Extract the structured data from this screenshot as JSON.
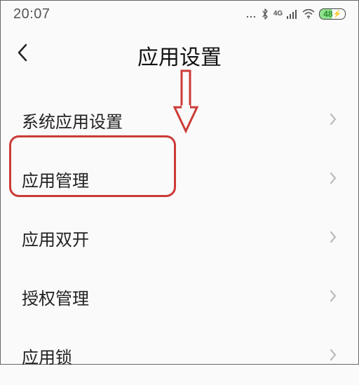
{
  "status": {
    "time": "20:07",
    "battery": "48"
  },
  "header": {
    "title": "应用设置"
  },
  "list": {
    "items": [
      {
        "label": "系统应用设置"
      },
      {
        "label": "应用管理"
      },
      {
        "label": "应用双开"
      },
      {
        "label": "授权管理"
      },
      {
        "label": "应用锁"
      }
    ]
  },
  "annotation": {
    "highlight_index": 1,
    "arrow_target": "应用管理"
  }
}
